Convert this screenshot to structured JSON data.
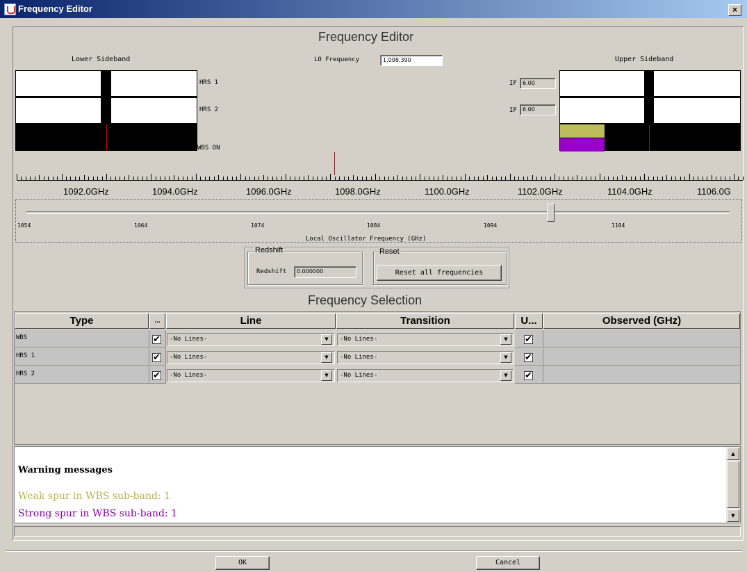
{
  "window": {
    "title": "Frequency Editor",
    "close_label": "×"
  },
  "header": {
    "title": "Frequency Editor"
  },
  "sidebands": {
    "lower_label": "Lower Sideband",
    "upper_label": "Upper Sideband",
    "lo_label": "LO Frequency",
    "lo_value": "1,098.390",
    "if_label": "IF",
    "hrs1_label": "HRS 1",
    "hrs2_label": "HRS 2",
    "wbs_label": "WBS ON",
    "hrs1_if": "6.00",
    "hrs2_if": "6.00",
    "weak_spur_color": "#bcbc5c",
    "strong_spur_color": "#9900cc"
  },
  "axis": {
    "ticks": [
      "1092.0GHz",
      "1094.0GHz",
      "1096.0GHz",
      "1098.0GHz",
      "1100.0GHz",
      "1102.0GHz",
      "1104.0GHz",
      "1106.0G"
    ]
  },
  "slider": {
    "labels": [
      "1054",
      "1064",
      "1074",
      "1084",
      "1094",
      "1104"
    ],
    "title": "Local Oscillator Frequency (GHz)",
    "position_fraction": 0.745
  },
  "redshift": {
    "group_label": "Redshift",
    "field_label": "Redshift",
    "value": "0.000000"
  },
  "reset": {
    "group_label": "Reset",
    "button_label": "Reset all frequencies"
  },
  "selection": {
    "title": "Frequency Selection",
    "columns": [
      "Type",
      "...",
      "Line",
      "Transition",
      "U...",
      "Observed (GHz)"
    ],
    "rows": [
      {
        "type": "WBS",
        "checked": "✔",
        "line": "-No Lines-",
        "transition": "-No Lines-",
        "u": "✔",
        "observed": ""
      },
      {
        "type": "HRS 1",
        "checked": "✔",
        "line": "-No Lines-",
        "transition": "-No Lines-",
        "u": "✔",
        "observed": ""
      },
      {
        "type": "HRS 2",
        "checked": "✔",
        "line": "-No Lines-",
        "transition": "-No Lines-",
        "u": "✔",
        "observed": ""
      }
    ]
  },
  "warnings": {
    "title": "Warning messages",
    "weak": "Weak spur in WBS sub-band: 1",
    "strong": "Strong spur in WBS sub-band: 1",
    "weak_color": "#b3b34d",
    "strong_color": "#8800aa"
  },
  "footer": {
    "ok_label": "OK",
    "cancel_label": "Cancel"
  }
}
